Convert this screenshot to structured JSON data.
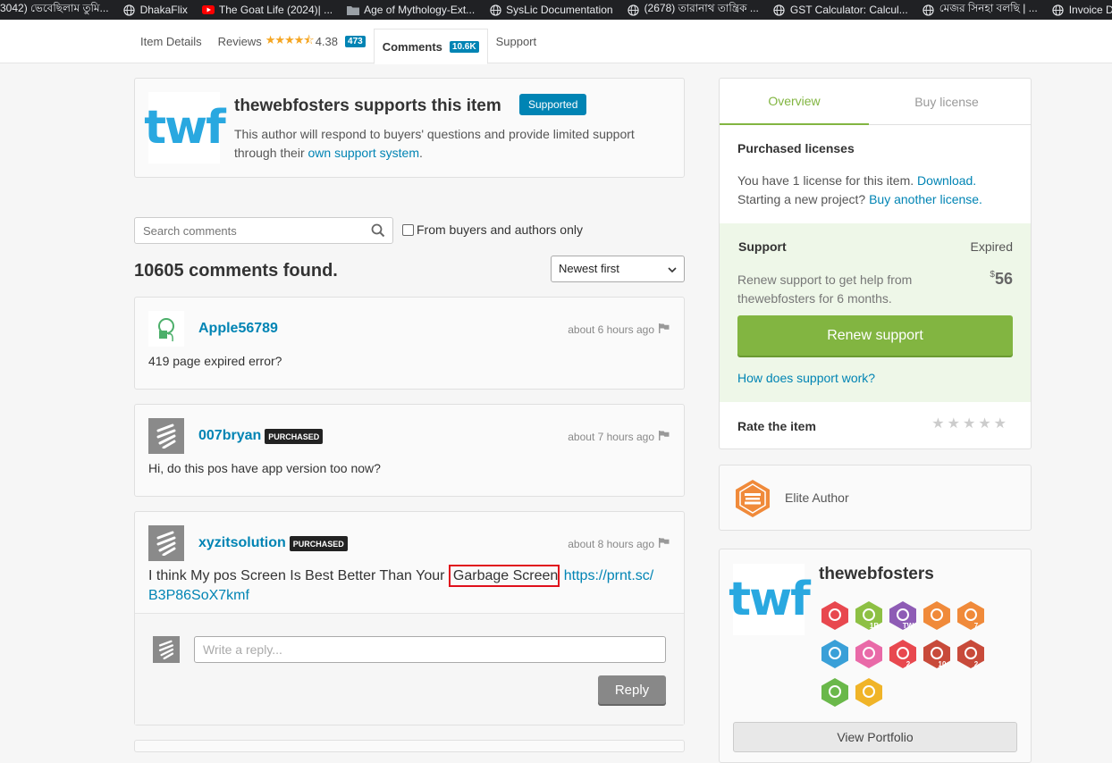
{
  "bookmarks": [
    {
      "label": "3042) ভেবেছিলাম তুমি...",
      "icon": "none"
    },
    {
      "label": "DhakaFlix",
      "icon": "globe-icon"
    },
    {
      "label": "The Goat Life (2024)| ...",
      "icon": "youtube-icon"
    },
    {
      "label": "Age of Mythology-Ext...",
      "icon": "folder-icon"
    },
    {
      "label": "SysLic Documentation",
      "icon": "globe-icon"
    },
    {
      "label": "(2678) তারানাথ তান্ত্রিক ...",
      "icon": "globe-icon"
    },
    {
      "label": "GST Calculator: Calcul...",
      "icon": "globe-icon"
    },
    {
      "label": "মেজর সিনহা বলছি | ...",
      "icon": "globe-icon"
    },
    {
      "label": "Invoice De",
      "icon": "globe-icon"
    }
  ],
  "tabs": {
    "item_details": "Item Details",
    "reviews": "Reviews",
    "reviews_stars": "★★★★⯪",
    "rating": "4.38",
    "reviews_count": "473",
    "comments": "Comments",
    "comments_count": "10.6K",
    "support": "Support"
  },
  "support_card": {
    "logo": "twf",
    "title": "thewebfosters supports this item",
    "badge": "Supported",
    "text": "This author will respond to buyers' questions and provide limited support through their ",
    "link": "own support system",
    "text_end": "."
  },
  "search": {
    "placeholder": "Search comments"
  },
  "filter_label": "From buyers and authors only",
  "found": "10605 comments found.",
  "sort": {
    "selected": "Newest first"
  },
  "comments": [
    {
      "user": "Apple56789",
      "purchased": "",
      "time": "about 6 hours ago",
      "text": "419 page expired error?"
    },
    {
      "user": "007bryan",
      "purchased": "PURCHASED",
      "time": "about 7 hours ago",
      "text": "Hi, do this pos have app version too now?"
    },
    {
      "user": "xyzitsolution",
      "purchased": "PURCHASED",
      "time": "about 8 hours ago",
      "text_before": "I think My pos Screen Is Best Better Than Your ",
      "text_highlight": "Garbage Screen",
      "link_line1": "https://prnt.sc/",
      "link_line2": "B3P86SoX7kmf"
    }
  ],
  "reply": {
    "placeholder": "Write a reply...",
    "button": "Reply"
  },
  "panel": {
    "tab_overview": "Overview",
    "tab_buy": "Buy license",
    "purchased_label": "Purchased licenses",
    "license_text": "You have 1 license for this item. ",
    "download": "Download.",
    "new_project": "Starting a new project? ",
    "buy_another": "Buy another license.",
    "support_label": "Support",
    "support_status": "Expired",
    "renew_text": "Renew support to get help from thewebfosters for 6 months.",
    "price_currency": "$",
    "price": "56",
    "renew_button": "Renew support",
    "how_link": "How does support work?",
    "rate_label": "Rate the item",
    "rate_stars": "★★★★★"
  },
  "elite": {
    "label": "Elite Author"
  },
  "author": {
    "logo": "twf",
    "name": "thewebfosters",
    "badges": [
      {
        "icon": "map-badge-icon",
        "color": "#e8484f",
        "label": ""
      },
      {
        "icon": "years-badge-icon",
        "color": "#8dc044",
        "label": "1B"
      },
      {
        "icon": "rocket-badge-icon",
        "color": "#8e5cb5",
        "label": "TW"
      },
      {
        "icon": "elite-badge-icon",
        "color": "#f08a3a",
        "label": ""
      },
      {
        "icon": "seven-badge-icon",
        "color": "#f08a3a",
        "label": "7"
      },
      {
        "icon": "bolt-badge-icon",
        "color": "#3aa0d8",
        "label": ""
      },
      {
        "icon": "diamond-badge-icon",
        "color": "#e96aa8",
        "label": ""
      },
      {
        "icon": "link-badge-icon",
        "color": "#e8484f",
        "label": "2"
      },
      {
        "icon": "paw-badge-icon",
        "color": "#c84a3a",
        "label": "10"
      },
      {
        "icon": "sc-badge-icon",
        "color": "#c84a3a",
        "label": "2"
      },
      {
        "icon": "pulse-badge-icon",
        "color": "#6ab84a",
        "label": ""
      },
      {
        "icon": "chat-badge-icon",
        "color": "#f0b428",
        "label": ""
      }
    ],
    "view_portfolio": "View Portfolio"
  },
  "colors": {
    "link": "#0084b4",
    "green": "#82b541",
    "highlight": "#e0101c"
  }
}
